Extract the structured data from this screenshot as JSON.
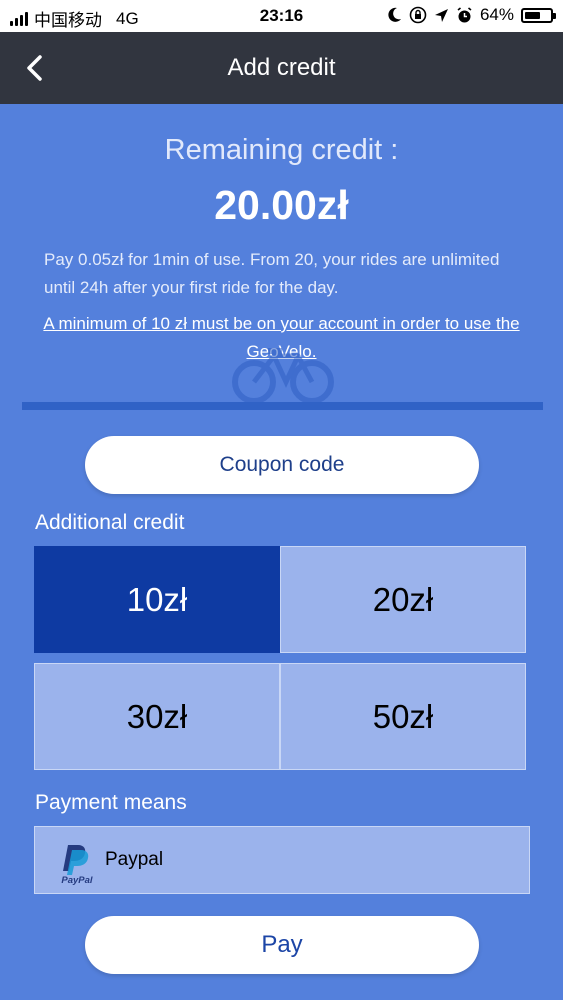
{
  "status_bar": {
    "carrier": "中国移动",
    "network": "4G",
    "time": "23:16",
    "battery": "64%",
    "battery_level": 0.64,
    "icons": [
      "moon-icon",
      "rotation-lock-icon",
      "location-arrow-icon",
      "alarm-icon"
    ]
  },
  "header": {
    "back_icon": "chevron-left-icon",
    "title": "Add credit"
  },
  "credit": {
    "label": "Remaining credit :",
    "amount": "20.00zł",
    "info": "Pay 0.05zł for 1min of use. From 20, your rides are unlimited until 24h after your first ride for the day.",
    "minimum_link": "A minimum of 10 zł must be on your account in order to use the GeoVelo."
  },
  "coupon_button": "Coupon code",
  "additional_credit": {
    "title": "Additional credit",
    "options": [
      "10zł",
      "20zł",
      "30zł",
      "50zł"
    ],
    "selected": "10zł"
  },
  "payment": {
    "title": "Payment means",
    "method_label": "Paypal",
    "logo_text": "PayPal"
  },
  "pay_button": "Pay",
  "colors": {
    "background": "#5480dc",
    "header": "#31353f",
    "selected_cell": "#0e3aa2",
    "cell": "#9bb3ec",
    "button_text": "#1c45a6"
  }
}
